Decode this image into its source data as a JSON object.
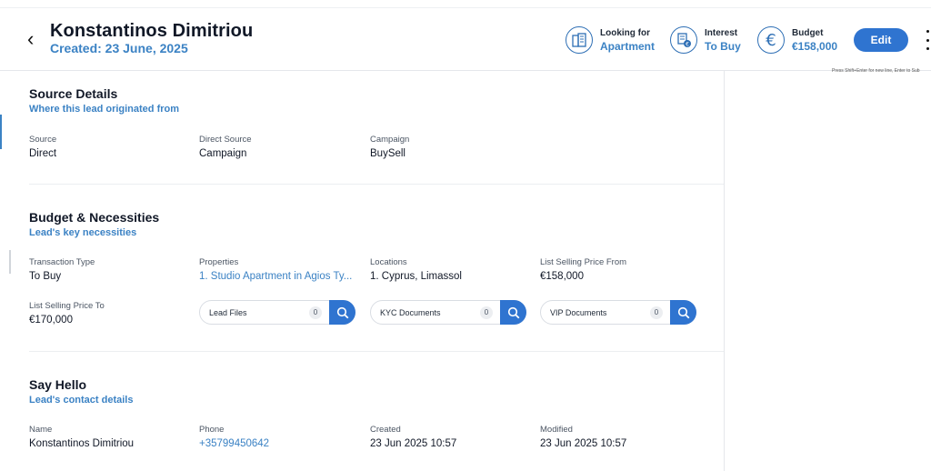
{
  "header": {
    "name": "Konstantinos Dimitriou",
    "created": "Created: 23 June, 2025",
    "chips": {
      "looking_for": {
        "label": "Looking for",
        "value": "Apartment",
        "icon": "building-icon"
      },
      "interest": {
        "label": "Interest",
        "value": "To Buy",
        "icon": "document-euro-icon"
      },
      "budget": {
        "label": "Budget",
        "value": "€158,000",
        "icon": "euro-icon"
      }
    },
    "edit_label": "Edit",
    "hint": "Press Shift+Enter for new line, Enter to Sub"
  },
  "source": {
    "title": "Source Details",
    "subtitle": "Where this lead originated from",
    "fields": [
      {
        "label": "Source",
        "value": "Direct"
      },
      {
        "label": "Direct Source",
        "value": "Campaign"
      },
      {
        "label": "Campaign",
        "value": "BuySell"
      }
    ]
  },
  "budget": {
    "title": "Budget & Necessities",
    "subtitle": "Lead's key necessities",
    "fields": [
      {
        "label": "Transaction Type",
        "value": "To Buy"
      },
      {
        "label": "Properties",
        "value": "1. Studio Apartment in Agios Ty..."
      },
      {
        "label": "Locations",
        "value": "1. Cyprus, Limassol"
      },
      {
        "label": "List Selling Price From",
        "value": "€158,000"
      },
      {
        "label": "List Selling Price To",
        "value": "€170,000"
      }
    ],
    "docs": [
      {
        "label": "Lead Files",
        "count": "0"
      },
      {
        "label": "KYC Documents",
        "count": "0"
      },
      {
        "label": "VIP Documents",
        "count": "0"
      }
    ]
  },
  "hello": {
    "title": "Say Hello",
    "subtitle": "Lead's contact details",
    "fields": [
      {
        "label": "Name",
        "value": "Konstantinos Dimitriou"
      },
      {
        "label": "Phone",
        "value": "+35799450642"
      },
      {
        "label": "Created",
        "value": "23 Jun 2025 10:57"
      },
      {
        "label": "Modified",
        "value": "23 Jun 2025 10:57"
      }
    ]
  },
  "colors": {
    "accent": "#2f74d0",
    "link": "#3b82c4"
  }
}
